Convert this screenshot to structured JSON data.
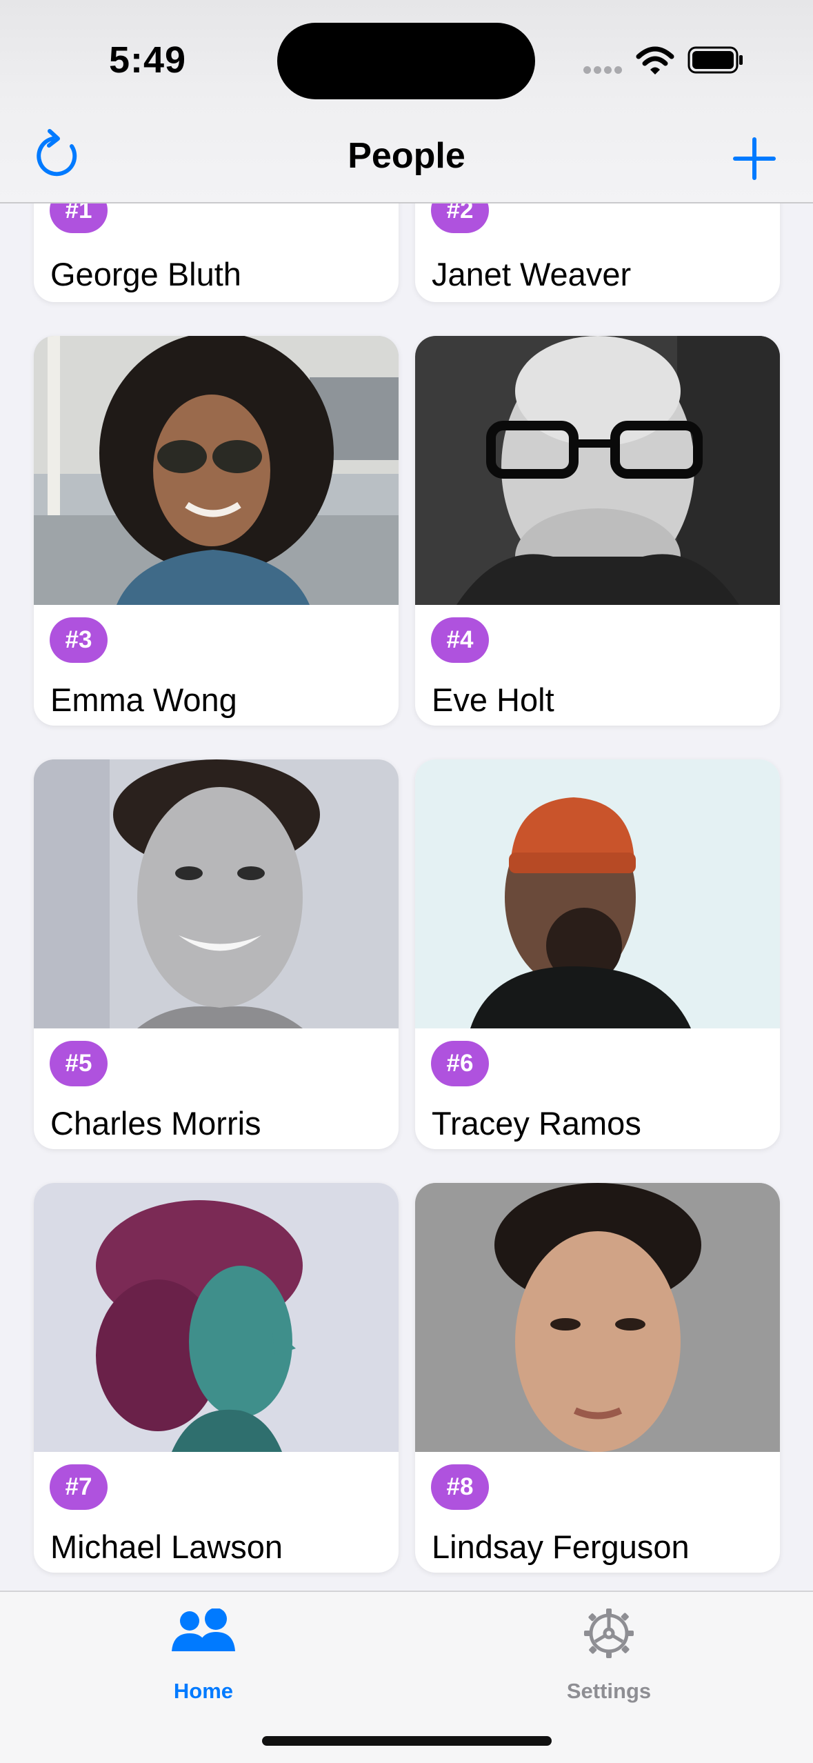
{
  "status_bar": {
    "time": "5:49"
  },
  "nav_bar": {
    "title": "People",
    "left_icon": "refresh-icon",
    "right_icon": "plus-icon"
  },
  "people": [
    {
      "badge": "#1",
      "name": "George Bluth"
    },
    {
      "badge": "#2",
      "name": "Janet Weaver"
    },
    {
      "badge": "#3",
      "name": "Emma Wong"
    },
    {
      "badge": "#4",
      "name": "Eve Holt"
    },
    {
      "badge": "#5",
      "name": "Charles Morris"
    },
    {
      "badge": "#6",
      "name": "Tracey Ramos"
    },
    {
      "badge": "#7",
      "name": "Michael Lawson"
    },
    {
      "badge": "#8",
      "name": "Lindsay Ferguson"
    }
  ],
  "tab_bar": {
    "tabs": [
      {
        "label": "Home",
        "icon": "people-icon",
        "selected": true
      },
      {
        "label": "Settings",
        "icon": "gear-icon",
        "selected": false
      }
    ]
  },
  "colors": {
    "accent": "#007aff",
    "badge": "#af52de",
    "background": "#f2f2f7",
    "inactive": "#8e8e93"
  }
}
